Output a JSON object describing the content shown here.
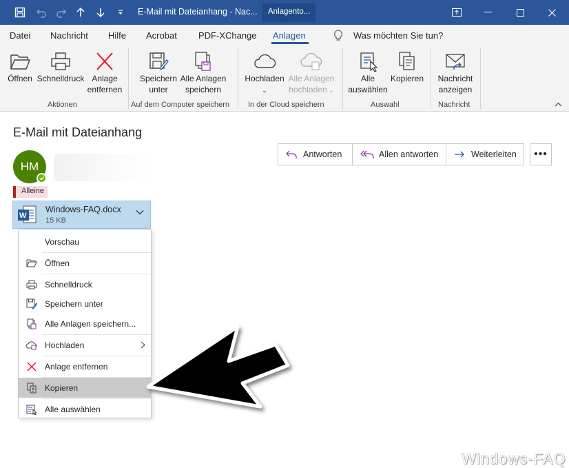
{
  "window": {
    "title": "E-Mail mit Dateianhang  -  Nac...",
    "context_tab": "Anlagento..."
  },
  "menu": {
    "items": [
      "Datei",
      "Nachricht",
      "Hilfe",
      "Acrobat",
      "PDF-XChange",
      "Anlagen"
    ],
    "search": "Was möchten Sie tun?"
  },
  "ribbon": {
    "buttons": {
      "open": "Öffnen",
      "quickprint": "Schnelldruck",
      "remove_1": "Anlage",
      "remove_2": "entfernen",
      "save_as_1": "Speichern",
      "save_as_2": "unter",
      "save_all_1": "Alle Anlagen",
      "save_all_2": "speichern",
      "upload": "Hochladen",
      "upload_all_1": "Alle Anlagen",
      "upload_all_2": "hochladen",
      "select_all_1": "Alle",
      "select_all_2": "auswählen",
      "copy": "Kopieren",
      "show_msg_1": "Nachricht",
      "show_msg_2": "anzeigen"
    },
    "groups": {
      "actions": "Aktionen",
      "save_local": "Auf dem Computer speichern",
      "cloud": "In der Cloud speichern",
      "selection": "Auswahl",
      "message": "Nachricht"
    }
  },
  "message": {
    "subject": "E-Mail mit Dateianhang",
    "avatar_initials": "HM",
    "category": "Alleine",
    "actions": {
      "reply": "Antworten",
      "reply_all": "Allen antworten",
      "forward": "Weiterleiten"
    },
    "attachment": {
      "name": "Windows-FAQ.docx",
      "size": "15 KB"
    }
  },
  "context_menu": {
    "items": [
      "Vorschau",
      "Öffnen",
      "Schnelldruck",
      "Speichern unter",
      "Alle Anlagen speichern...",
      "Hochladen",
      "Anlage entfernen",
      "Kopieren",
      "Alle auswählen"
    ],
    "highlighted": "Kopieren"
  },
  "watermark": "Windows-FAQ",
  "colors": {
    "titlebar": "#2b579a",
    "accent": "#2b579a",
    "avatar": "#498205",
    "category": "#a4262c",
    "attachment_bg": "#bcd9ee",
    "remove_red": "#e81123"
  }
}
